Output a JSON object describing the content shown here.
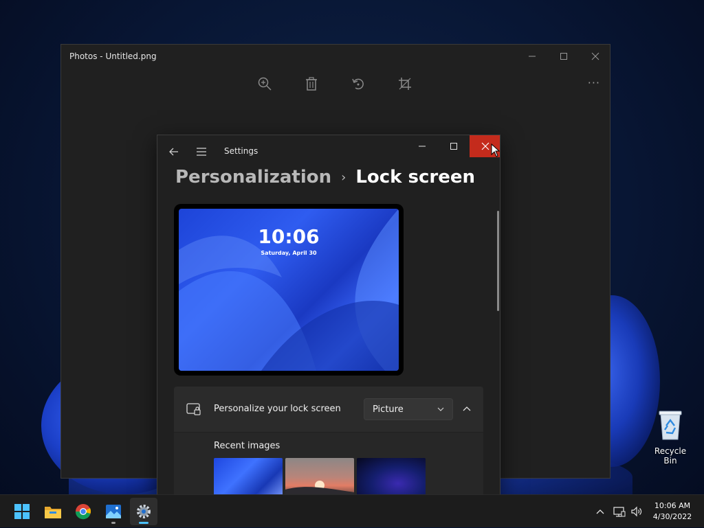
{
  "photos": {
    "title": "Photos - Untitled.png",
    "toolbar": [
      "zoom-in-icon",
      "delete-icon",
      "rotate-icon",
      "crop-icon"
    ],
    "more": "···",
    "controls": [
      "minimize",
      "maximize",
      "close"
    ]
  },
  "settings": {
    "title": "Settings",
    "breadcrumb": {
      "parent": "Personalization",
      "separator": "›",
      "current": "Lock screen"
    },
    "preview": {
      "time": "10:06",
      "date": "Saturday, April 30"
    },
    "personalize": {
      "label": "Personalize your lock screen",
      "selected": "Picture"
    },
    "recent": {
      "label": "Recent images",
      "images": [
        "blue-bloom",
        "sunset-beach",
        "dark-gradient"
      ]
    }
  },
  "desktop": {
    "recycle_bin_label": "Recycle Bin"
  },
  "taskbar": {
    "apps": [
      "start",
      "file-explorer",
      "chrome",
      "photos",
      "settings"
    ],
    "clock": {
      "time": "10:06 AM",
      "date": "4/30/2022"
    }
  },
  "colors": {
    "close_hover": "#c42b1c",
    "window_bg": "#202020",
    "accent": "#4cc2ff"
  }
}
